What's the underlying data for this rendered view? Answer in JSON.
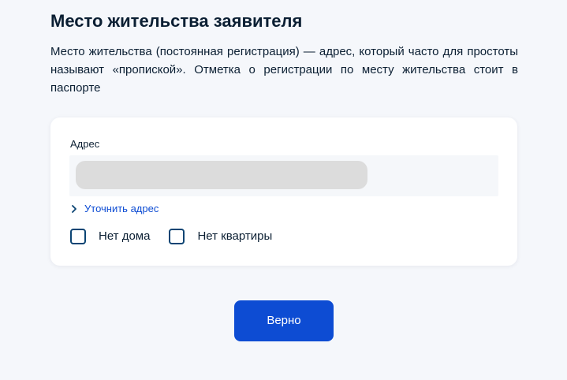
{
  "header": {
    "title": "Место жительства заявителя",
    "description": "Место жительства (постоянная регистрация) — адрес, который часто для простоты называют «пропиской». Отметка о регистрации по месту жительства стоит в паспорте"
  },
  "address_card": {
    "field_label": "Адрес",
    "refine_link": "Уточнить адрес",
    "checkboxes": [
      {
        "label": "Нет дома",
        "checked": false
      },
      {
        "label": "Нет квартиры",
        "checked": false
      }
    ]
  },
  "actions": {
    "submit_label": "Верно"
  },
  "colors": {
    "primary": "#0d4cd3",
    "checkbox_border": "#0b4473",
    "text": "#0b1f33",
    "background": "#f5f7fb",
    "skeleton": "#dcdcdc"
  },
  "icons": {
    "refine_link": "chevron-right-icon"
  }
}
